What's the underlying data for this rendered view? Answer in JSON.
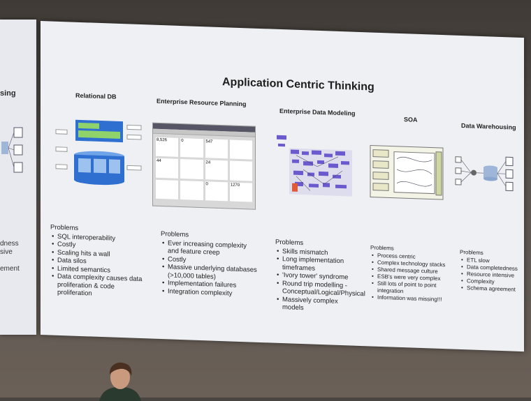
{
  "slide": {
    "title": "Application Centric Thinking",
    "columns": [
      {
        "title": "Relational DB",
        "problems_label": "Problems",
        "problems": [
          "SQL interoperability",
          "Costly",
          "Scaling hits a wall",
          "Data silos",
          "Limited semantics",
          "Data complexity causes data proliferation & code proliferation"
        ]
      },
      {
        "title": "Enterprise Resource Planning",
        "problems_label": "Problems",
        "problems": [
          "Ever increasing complexity and feature creep",
          "Costly",
          "Massive underlying databases (>10,000 tables)",
          "Implementation failures",
          "Integration complexity"
        ]
      },
      {
        "title": "Enterprise Data Modeling",
        "problems_label": "Problems",
        "problems": [
          "Skills mismatch",
          "Long implementation timeframes",
          "'Ivory tower' syndrome",
          "Round trip modelling - Conceptual/Logical/Physical",
          "Massively complex models"
        ]
      },
      {
        "title": "SOA",
        "problems_label": "Problems",
        "problems": [
          "Process centric",
          "Complex technology stacks",
          "Shared message culture",
          "ESB's were very complex",
          "Still lots of point to point integration",
          "Information was missing!!!"
        ]
      },
      {
        "title": "Data Warehousing",
        "problems_label": "Problems",
        "problems": [
          "ETL slow",
          "Data completedness",
          "Resource intensive",
          "Complexity",
          "Schema agreement"
        ]
      }
    ]
  },
  "left_slide": {
    "title_fragment": "sing",
    "text_fragments": [
      "dness",
      "sive",
      "ement"
    ]
  },
  "erp_screen": {
    "numbers": [
      "8,526",
      "0",
      "547",
      "44",
      "24",
      "0",
      "1270"
    ]
  },
  "colors": {
    "screen": "#eef0f4",
    "db_blue": "#2f6fd0",
    "db_green": "#8fd36a",
    "model_purple": "#6a5acd"
  }
}
